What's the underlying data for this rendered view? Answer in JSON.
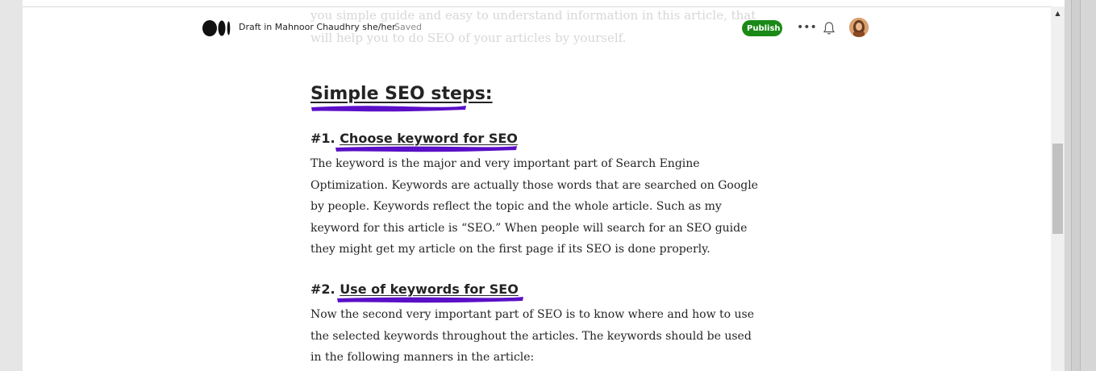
{
  "header": {
    "draft_label": "Draft in Mahnoor Chaudhry she/her",
    "saved_label": "Saved",
    "publish_label": "Publish",
    "more_label": "•••"
  },
  "faded_intro": {
    "lines": [
      "you simple guide and easy to understand information in this article, that",
      "will help you to do SEO of your articles by yourself."
    ]
  },
  "article": {
    "heading": "Simple SEO steps:",
    "section1": {
      "prefix": "#1. ",
      "title": "Choose keyword for SEO",
      "lines": [
        "The keyword is the major and very important part of Search Engine",
        "Optimization. Keywords are actually those words that are searched on Google",
        "by people. Keywords reflect the topic and the whole article. Such as my",
        "keyword for this article is “SEO.” When people will search for an SEO guide",
        "they might get my article on the first page if its SEO is done properly."
      ]
    },
    "section2": {
      "prefix": "#2. ",
      "title": "Use of keywords for SEO",
      "lines": [
        "Now the second very important part of SEO is to know where and how to use",
        "the selected keywords throughout the articles. The keywords should be used",
        "in the following manners in the article:"
      ]
    }
  },
  "colors": {
    "publish_green": "#1a8917",
    "highlight_purple": "#5b0fc7",
    "text": "#242424"
  },
  "icons": {
    "logo": "medium-logo-icon",
    "bell": "bell-icon",
    "more": "more-horizontal-icon",
    "scroll_up": "scroll-up-arrow-icon"
  }
}
